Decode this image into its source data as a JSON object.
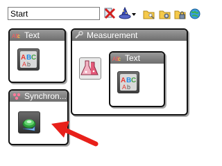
{
  "toolbar": {
    "start_input_value": "Start",
    "buttons": [
      "delete-icon",
      "wizard-icon",
      "dropdown-arrow-icon",
      "folder-key-icon",
      "folder-gear-icon",
      "folder-lock-icon",
      "globe-icon"
    ]
  },
  "blocks": {
    "text": {
      "title": "Text"
    },
    "measurement": {
      "title": "Measurement"
    },
    "nested_text": {
      "title": "Text"
    },
    "synchron": {
      "title": "Synchron..."
    }
  },
  "icons": {
    "text_tile": "abc-text-icon",
    "measurement_tile": "chemistry-flask-icon",
    "synchron_tile": "sync-icon"
  },
  "annotation": {
    "arrow_color": "#e8201a"
  },
  "colors": {
    "header_gradient_top": "#9a9a9a",
    "header_gradient_bottom": "#6e6e6e",
    "tile_dark": "#3f3f3f"
  }
}
